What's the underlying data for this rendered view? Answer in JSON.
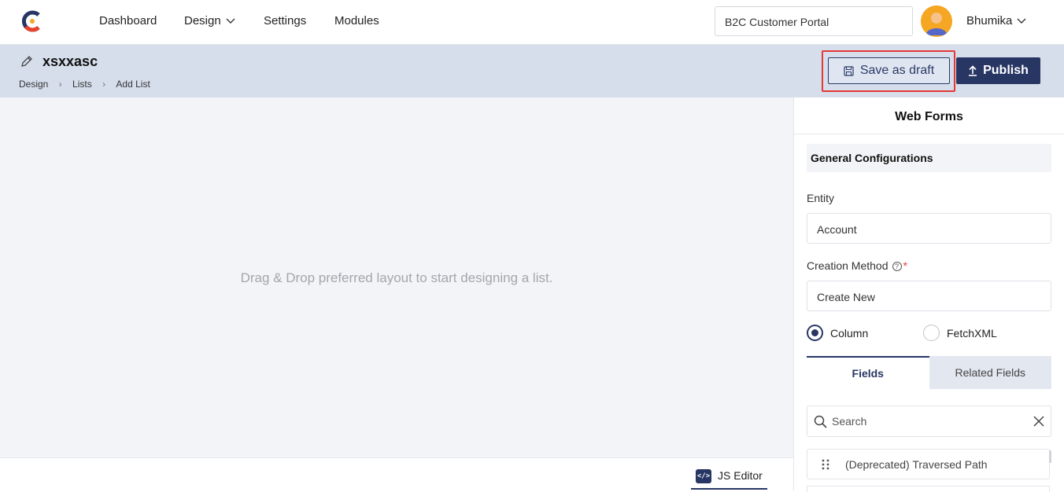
{
  "nav": {
    "items": [
      {
        "label": "Dashboard"
      },
      {
        "label": "Design",
        "has_dropdown": true
      },
      {
        "label": "Settings"
      },
      {
        "label": "Modules"
      }
    ],
    "portal_value": "B2C Customer Portal",
    "user_name": "Bhumika"
  },
  "header": {
    "title": "xsxxasc",
    "breadcrumb": [
      "Design",
      "Lists",
      "Add List"
    ],
    "save_draft_label": "Save as draft",
    "publish_label": "Publish"
  },
  "canvas": {
    "hint": "Drag & Drop preferred layout to start designing a list.",
    "js_editor_label": "JS Editor"
  },
  "panel": {
    "title": "Web Forms",
    "section_title": "General Configurations",
    "entity_label": "Entity",
    "entity_value": "Account",
    "creation_method_label": "Creation Method",
    "creation_method_required": "*",
    "creation_method_value": "Create New",
    "radio_options": [
      {
        "label": "Column",
        "selected": true
      },
      {
        "label": "FetchXML",
        "selected": false
      }
    ],
    "tabs": [
      {
        "label": "Fields",
        "active": true
      },
      {
        "label": "Related Fields",
        "active": false
      }
    ],
    "search_placeholder": "Search",
    "fields": [
      "(Deprecated) Traversed Path"
    ]
  },
  "colors": {
    "primary": "#283664",
    "subheader_bg": "#d6deec",
    "canvas_bg": "#f3f4f8",
    "highlight": "#e53935"
  }
}
